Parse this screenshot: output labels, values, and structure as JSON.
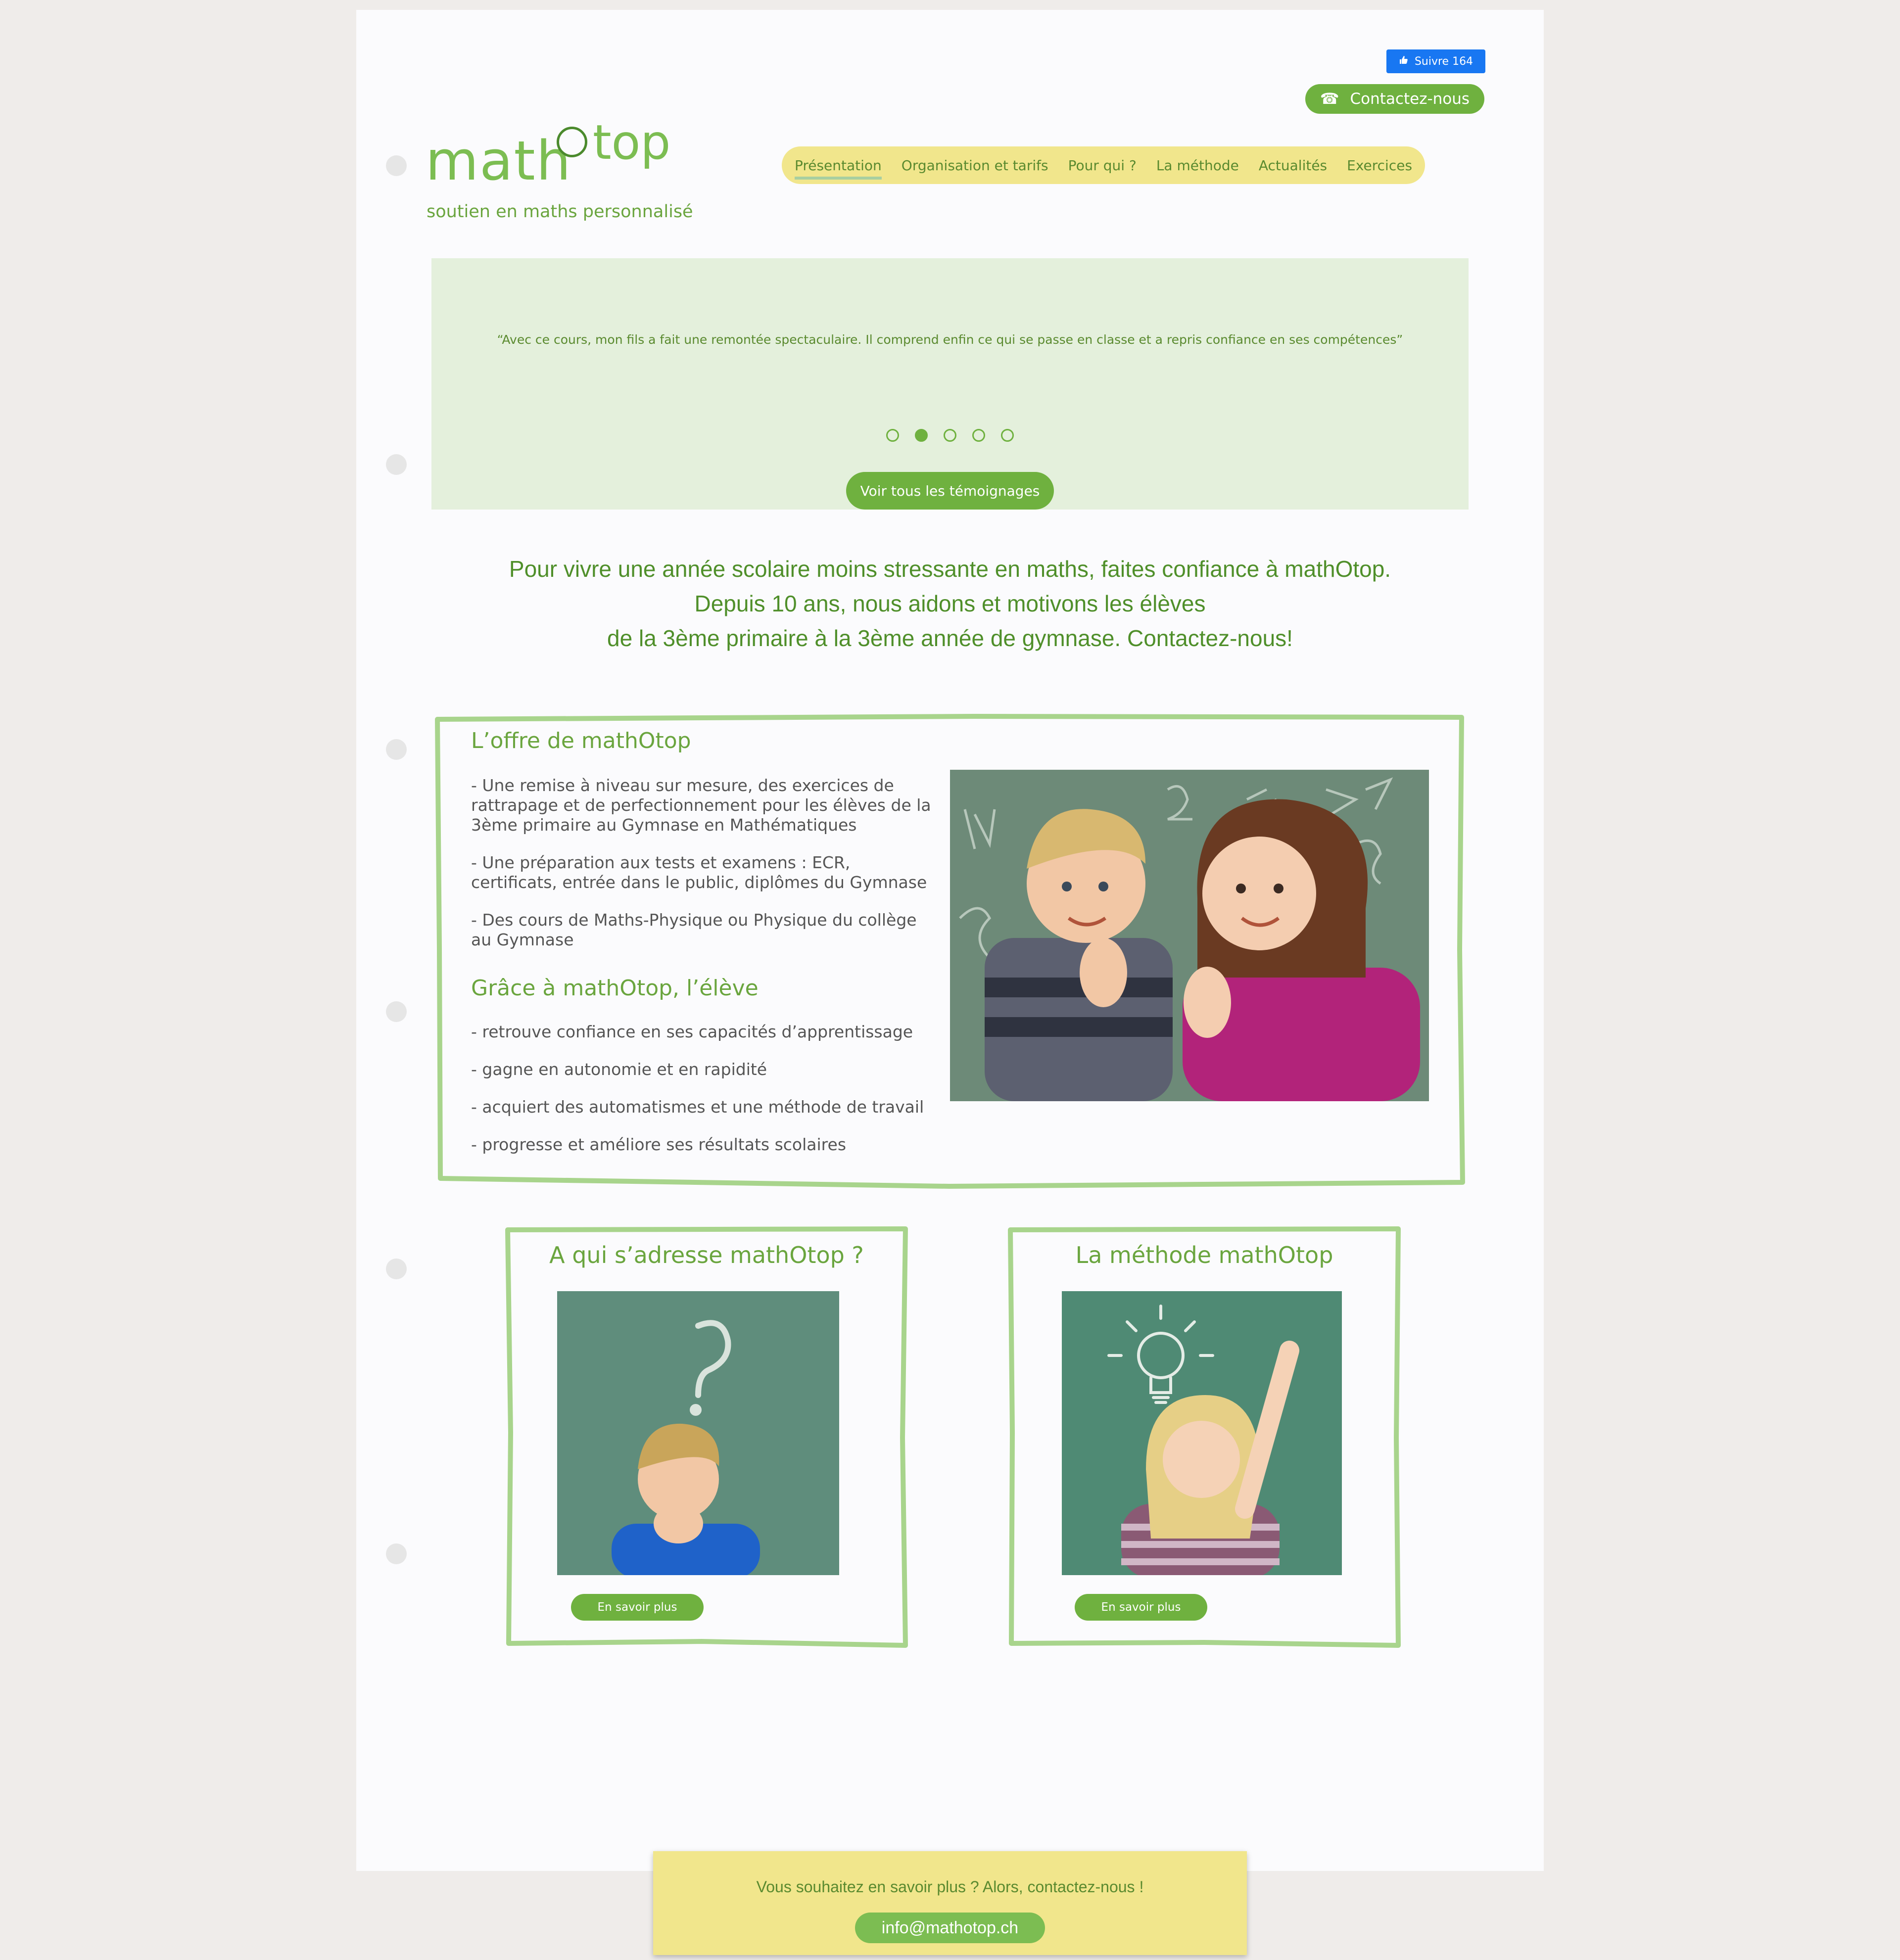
{
  "social": {
    "follow_label": "Suivre 164",
    "like_icon": "thumbs-up-icon"
  },
  "header": {
    "contact_label": "Contactez-nous",
    "phone_icon": "☎",
    "logo_math": "math",
    "logo_top": "top",
    "tagline": "soutien en maths personnalisé"
  },
  "nav": {
    "items": [
      {
        "label": "Présentation",
        "active": true
      },
      {
        "label": "Organisation et tarifs"
      },
      {
        "label": "Pour qui ?"
      },
      {
        "label": "La méthode"
      },
      {
        "label": "Actualités"
      },
      {
        "label": "Exercices"
      }
    ]
  },
  "testimonials": {
    "quote": "“Avec ce cours, mon fils a fait une remontée spectaculaire. Il comprend enfin ce qui se passe en classe et a repris confiance en ses compétences”",
    "slide_count": 5,
    "active_slide": 2,
    "button_label": "Voir tous les témoignages"
  },
  "intro": {
    "line1": "Pour vivre une année scolaire moins stressante en maths, faites confiance à mathOtop.",
    "line2": "Depuis 10 ans, nous aidons et motivons les élèves",
    "line3": "de la 3ème primaire à la 3ème année de gymnase. Contactez-nous!"
  },
  "offer": {
    "title": "L’offre de mathOtop",
    "items": [
      "- Une remise à niveau sur mesure, des exercices de rattrapage et de perfectionnement pour les élèves de la 3ème primaire au Gymnase en Mathématiques",
      "- Une préparation aux tests et examens : ECR, certificats, entrée dans le public, diplômes du Gymnase",
      "- Des cours de Maths-Physique ou Physique du collège au Gymnase"
    ],
    "benefits_title": "Grâce à mathOtop, l’élève",
    "benefits": [
      "- retrouve confiance en ses capacités d’apprentissage",
      "- gagne en autonomie et en rapidité",
      "- acquiert des automatismes et une méthode de travail",
      "- progresse et améliore ses résultats scolaires"
    ]
  },
  "cards": {
    "who": {
      "title": "A qui s’adresse mathOtop ?",
      "button": "En savoir plus"
    },
    "method": {
      "title": "La méthode mathOtop",
      "button": "En savoir plus"
    }
  },
  "footer": {
    "text": "Vous souhaitez en savoir plus ? Alors, contactez-nous !",
    "email": "info@mathotop.ch"
  },
  "colors": {
    "accent": "#6fb13f",
    "nav_bg": "#f1e68c",
    "banner_bg": "#e4f0dc",
    "frame": "#a8d48c"
  }
}
